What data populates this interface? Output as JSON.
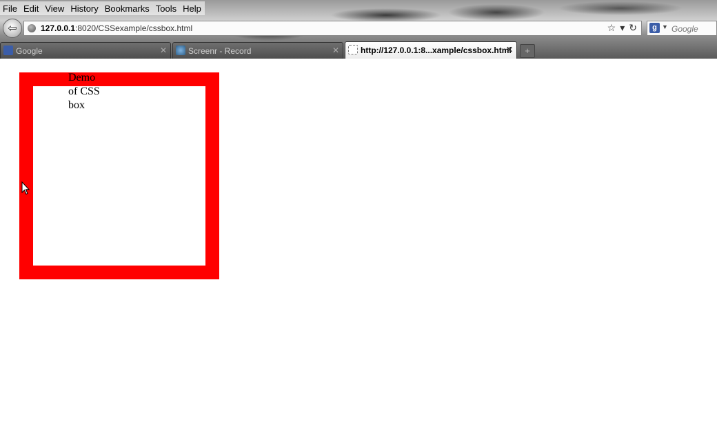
{
  "menubar": {
    "items": [
      {
        "label": "File"
      },
      {
        "label": "Edit"
      },
      {
        "label": "View"
      },
      {
        "label": "History"
      },
      {
        "label": "Bookmarks"
      },
      {
        "label": "Tools"
      },
      {
        "label": "Help"
      }
    ]
  },
  "navbar": {
    "url_host": "127.0.0.1",
    "url_rest": ":8020/CSSexample/cssbox.html",
    "search_placeholder": "Google",
    "search_engine_icon": "google-g-icon"
  },
  "tabs": [
    {
      "label": "Google",
      "active": false,
      "icon": "google-icon"
    },
    {
      "label": "Screenr - Record",
      "active": false,
      "icon": "screenr-icon"
    },
    {
      "label": "http://127.0.0.1:8...xample/cssbox.html",
      "active": true,
      "icon": "blank-page-icon"
    }
  ],
  "page": {
    "box_text_lines": [
      "Demo",
      "of CSS",
      "box"
    ],
    "box_border_color": "#ff0000"
  }
}
